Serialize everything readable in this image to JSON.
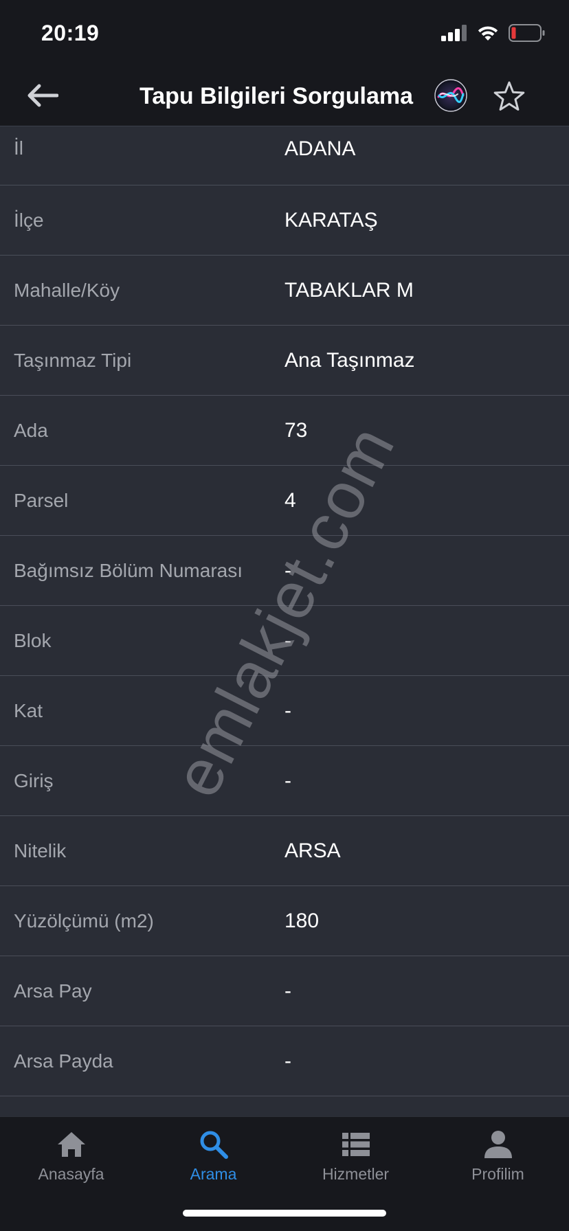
{
  "status_bar": {
    "time": "20:19"
  },
  "nav": {
    "title": "Tapu Bilgileri Sorgulama"
  },
  "rows": [
    {
      "label": "İl",
      "value": "ADANA"
    },
    {
      "label": "İlçe",
      "value": "KARATAŞ"
    },
    {
      "label": "Mahalle/Köy",
      "value": "TABAKLAR M"
    },
    {
      "label": "Taşınmaz Tipi",
      "value": "Ana Taşınmaz"
    },
    {
      "label": "Ada",
      "value": "73"
    },
    {
      "label": "Parsel",
      "value": "4"
    },
    {
      "label": "Bağımsız Bölüm Numarası",
      "value": "-"
    },
    {
      "label": "Blok",
      "value": "-"
    },
    {
      "label": "Kat",
      "value": "-"
    },
    {
      "label": "Giriş",
      "value": "-"
    },
    {
      "label": "Nitelik",
      "value": "ARSA"
    },
    {
      "label": "Yüzölçümü (m2)",
      "value": "180"
    },
    {
      "label": "Arsa Pay",
      "value": "-"
    },
    {
      "label": "Arsa Payda",
      "value": "-"
    }
  ],
  "watermark": "emlakjet.com",
  "tabs": [
    {
      "label": "Anasayfa",
      "icon": "home-icon",
      "active": false
    },
    {
      "label": "Arama",
      "icon": "search-icon",
      "active": true
    },
    {
      "label": "Hizmetler",
      "icon": "list-icon",
      "active": false
    },
    {
      "label": "Profilim",
      "icon": "person-icon",
      "active": false
    }
  ],
  "colors": {
    "background": "#2a2d36",
    "bar": "#17181d",
    "accent": "#2f8ee6",
    "label": "#a4a7ae",
    "value": "#ffffff",
    "battery_low": "#e5393a"
  }
}
